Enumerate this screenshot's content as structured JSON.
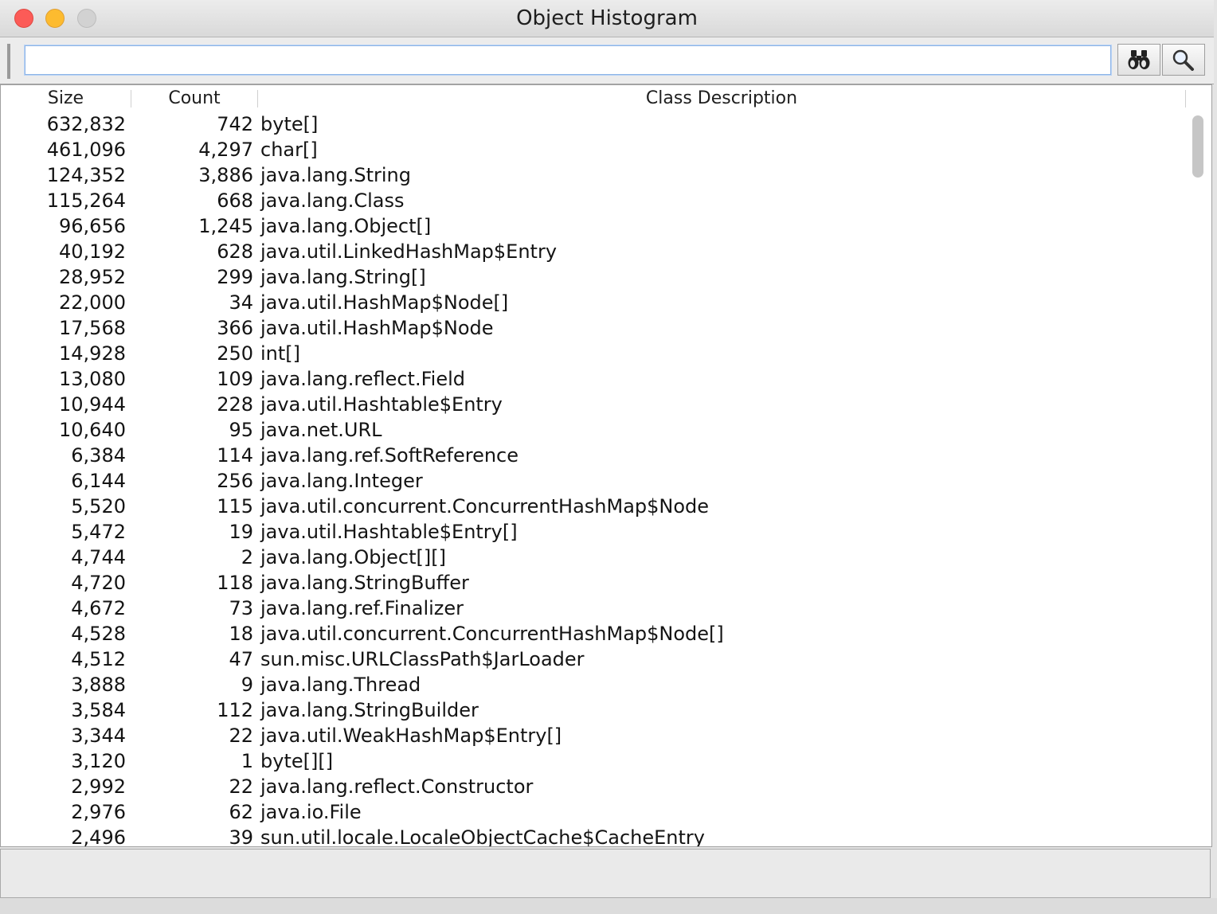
{
  "window": {
    "title": "Object Histogram"
  },
  "search": {
    "value": "",
    "placeholder": ""
  },
  "toolbar": {
    "find_icon": "binoculars-icon",
    "inspect_icon": "magnifier-icon"
  },
  "table": {
    "columns": [
      "Size",
      "Count",
      "Class Description"
    ],
    "rows": [
      {
        "size": "632,832",
        "count": "742",
        "desc": "byte[]"
      },
      {
        "size": "461,096",
        "count": "4,297",
        "desc": "char[]"
      },
      {
        "size": "124,352",
        "count": "3,886",
        "desc": "java.lang.String"
      },
      {
        "size": "115,264",
        "count": "668",
        "desc": "java.lang.Class"
      },
      {
        "size": "96,656",
        "count": "1,245",
        "desc": "java.lang.Object[]"
      },
      {
        "size": "40,192",
        "count": "628",
        "desc": "java.util.LinkedHashMap$Entry"
      },
      {
        "size": "28,952",
        "count": "299",
        "desc": "java.lang.String[]"
      },
      {
        "size": "22,000",
        "count": "34",
        "desc": "java.util.HashMap$Node[]"
      },
      {
        "size": "17,568",
        "count": "366",
        "desc": "java.util.HashMap$Node"
      },
      {
        "size": "14,928",
        "count": "250",
        "desc": "int[]"
      },
      {
        "size": "13,080",
        "count": "109",
        "desc": "java.lang.reflect.Field"
      },
      {
        "size": "10,944",
        "count": "228",
        "desc": "java.util.Hashtable$Entry"
      },
      {
        "size": "10,640",
        "count": "95",
        "desc": "java.net.URL"
      },
      {
        "size": "6,384",
        "count": "114",
        "desc": "java.lang.ref.SoftReference"
      },
      {
        "size": "6,144",
        "count": "256",
        "desc": "java.lang.Integer"
      },
      {
        "size": "5,520",
        "count": "115",
        "desc": "java.util.concurrent.ConcurrentHashMap$Node"
      },
      {
        "size": "5,472",
        "count": "19",
        "desc": "java.util.Hashtable$Entry[]"
      },
      {
        "size": "4,744",
        "count": "2",
        "desc": "java.lang.Object[][]"
      },
      {
        "size": "4,720",
        "count": "118",
        "desc": "java.lang.StringBuffer"
      },
      {
        "size": "4,672",
        "count": "73",
        "desc": "java.lang.ref.Finalizer"
      },
      {
        "size": "4,528",
        "count": "18",
        "desc": "java.util.concurrent.ConcurrentHashMap$Node[]"
      },
      {
        "size": "4,512",
        "count": "47",
        "desc": "sun.misc.URLClassPath$JarLoader"
      },
      {
        "size": "3,888",
        "count": "9",
        "desc": "java.lang.Thread"
      },
      {
        "size": "3,584",
        "count": "112",
        "desc": "java.lang.StringBuilder"
      },
      {
        "size": "3,344",
        "count": "22",
        "desc": "java.util.WeakHashMap$Entry[]"
      },
      {
        "size": "3,120",
        "count": "1",
        "desc": "byte[][]"
      },
      {
        "size": "2,992",
        "count": "22",
        "desc": "java.lang.reflect.Constructor"
      },
      {
        "size": "2,976",
        "count": "62",
        "desc": "java.io.File"
      },
      {
        "size": "2,496",
        "count": "39",
        "desc": "sun.util.locale.LocaleObjectCache$CacheEntry"
      }
    ]
  },
  "status": {
    "text": ""
  }
}
